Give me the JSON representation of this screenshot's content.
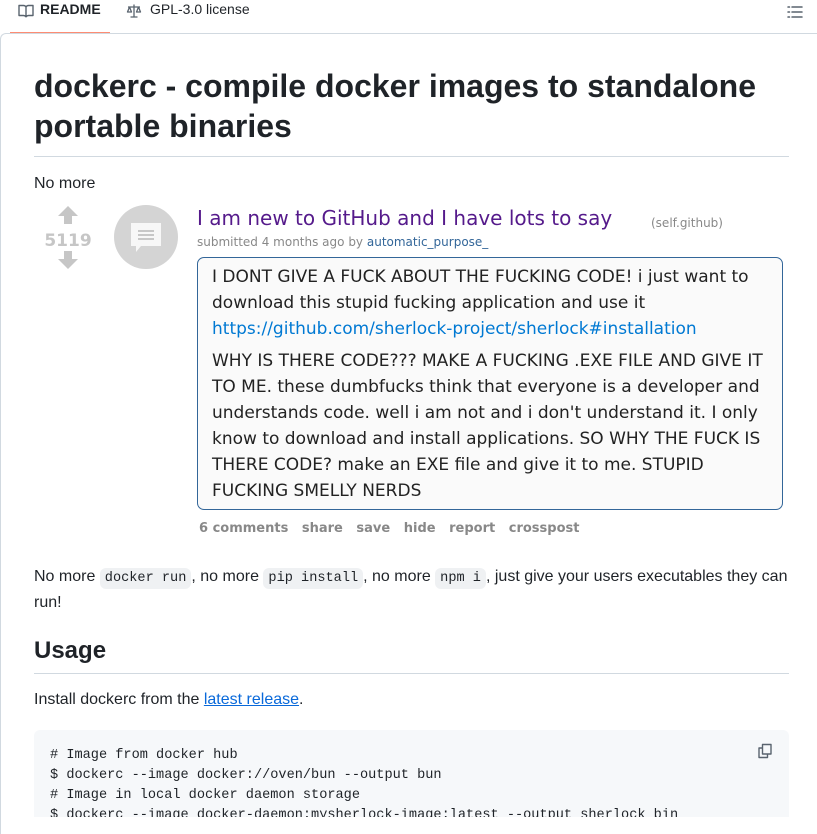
{
  "tabs": {
    "readme": "README",
    "license": "GPL-3.0 license"
  },
  "readme": {
    "title": "dockerc - compile docker images to standalone portable binaries",
    "intro": "No more",
    "usage_heading": "Usage",
    "install_prefix": "Install dockerc from the ",
    "install_link": "latest release",
    "install_suffix": ".",
    "para": {
      "t1": "No more ",
      "c1": "docker run",
      "t2": ", no more ",
      "c2": "pip install",
      "t3": ", no more ",
      "c3": "npm i",
      "t4": ", just give your users executables they can run!"
    },
    "code_lines": [
      "# Image from docker hub",
      "$ dockerc --image docker://oven/bun --output bun",
      "# Image in local docker daemon storage",
      "$ dockerc --image docker-daemon:mysherlock-image:latest --output sherlock_bin"
    ]
  },
  "post": {
    "score": "5119",
    "title": "I am new to GitHub and I have lots to say",
    "domain": "(self.github)",
    "submitted": "submitted 4 months ago by ",
    "author": "automatic_purpose_",
    "selftext_p1": "I DONT GIVE A FUCK ABOUT THE FUCKING CODE! i just want to download this stupid fucking application and use it",
    "selftext_link": "https://github.com/sherlock-project/sherlock#installation",
    "selftext_p2": "WHY IS THERE CODE??? MAKE A FUCKING .EXE FILE AND GIVE IT TO ME. these dumbfucks think that everyone is a developer and understands code. well i am not and i don't understand it. I only know to download and install applications. SO WHY THE FUCK IS THERE CODE? make an EXE file and give it to me. STUPID FUCKING SMELLY NERDS",
    "buttons": [
      "6 comments",
      "share",
      "save",
      "hide",
      "report",
      "crosspost"
    ]
  },
  "icons": {
    "readme": "book-icon",
    "license": "scale-icon",
    "toc": "list-icon",
    "copy": "copy-icon",
    "thumb": "self-post-icon"
  },
  "colors": {
    "tab_underline": "#fd8c73",
    "post_title": "#551a8b",
    "link": "#0969da",
    "author": "#336699"
  }
}
